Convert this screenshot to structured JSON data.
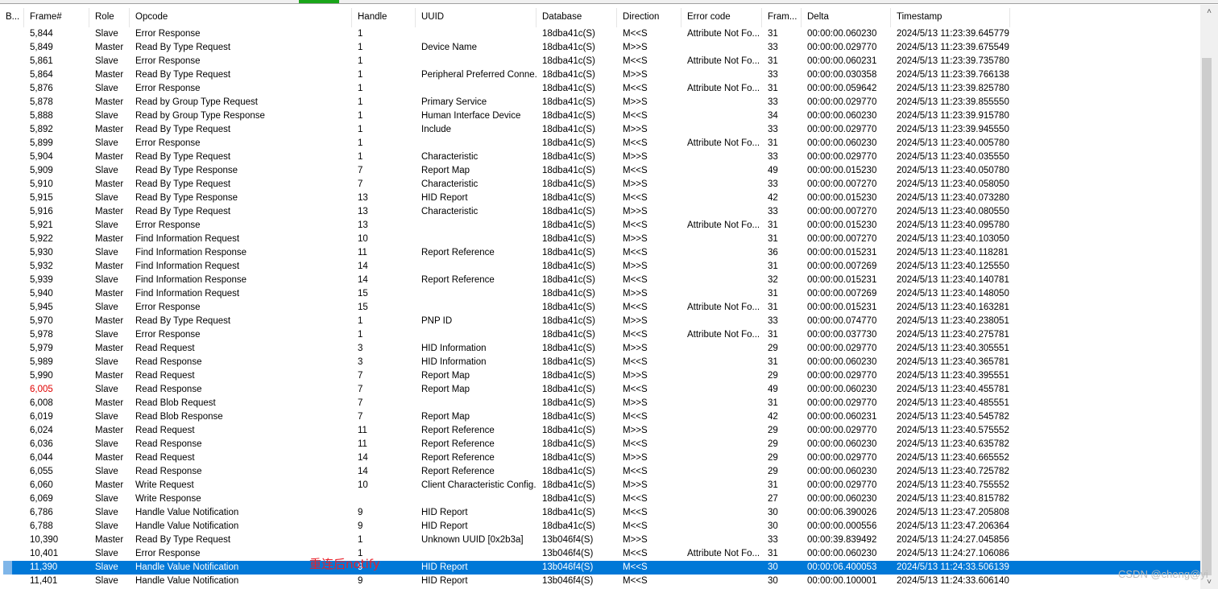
{
  "columns": [
    "B...",
    "Frame#",
    "Role",
    "Opcode",
    "Handle",
    "UUID",
    "Database",
    "Direction",
    "Error code",
    "Fram...",
    "Delta",
    "Timestamp"
  ],
  "rows": [
    [
      "",
      "5,844",
      "Slave",
      "Error Response",
      "1",
      "",
      "18dba41c(S)",
      "M<<S",
      "Attribute Not Fo...",
      "31",
      "00:00:00.060230",
      "2024/5/13 11:23:39.645779"
    ],
    [
      "",
      "5,849",
      "Master",
      "Read By Type Request",
      "1",
      "Device Name",
      "18dba41c(S)",
      "M>>S",
      "",
      "33",
      "00:00:00.029770",
      "2024/5/13 11:23:39.675549"
    ],
    [
      "",
      "5,861",
      "Slave",
      "Error Response",
      "1",
      "",
      "18dba41c(S)",
      "M<<S",
      "Attribute Not Fo...",
      "31",
      "00:00:00.060231",
      "2024/5/13 11:23:39.735780"
    ],
    [
      "",
      "5,864",
      "Master",
      "Read By Type Request",
      "1",
      "Peripheral Preferred Conne...",
      "18dba41c(S)",
      "M>>S",
      "",
      "33",
      "00:00:00.030358",
      "2024/5/13 11:23:39.766138"
    ],
    [
      "",
      "5,876",
      "Slave",
      "Error Response",
      "1",
      "",
      "18dba41c(S)",
      "M<<S",
      "Attribute Not Fo...",
      "31",
      "00:00:00.059642",
      "2024/5/13 11:23:39.825780"
    ],
    [
      "",
      "5,878",
      "Master",
      "Read by Group Type Request",
      "1",
      "Primary Service",
      "18dba41c(S)",
      "M>>S",
      "",
      "33",
      "00:00:00.029770",
      "2024/5/13 11:23:39.855550"
    ],
    [
      "",
      "5,888",
      "Slave",
      "Read by Group Type Response",
      "1",
      "Human Interface Device",
      "18dba41c(S)",
      "M<<S",
      "",
      "34",
      "00:00:00.060230",
      "2024/5/13 11:23:39.915780"
    ],
    [
      "",
      "5,892",
      "Master",
      "Read By Type Request",
      "1",
      "Include",
      "18dba41c(S)",
      "M>>S",
      "",
      "33",
      "00:00:00.029770",
      "2024/5/13 11:23:39.945550"
    ],
    [
      "",
      "5,899",
      "Slave",
      "Error Response",
      "1",
      "",
      "18dba41c(S)",
      "M<<S",
      "Attribute Not Fo...",
      "31",
      "00:00:00.060230",
      "2024/5/13 11:23:40.005780"
    ],
    [
      "",
      "5,904",
      "Master",
      "Read By Type Request",
      "1",
      "Characteristic",
      "18dba41c(S)",
      "M>>S",
      "",
      "33",
      "00:00:00.029770",
      "2024/5/13 11:23:40.035550"
    ],
    [
      "",
      "5,909",
      "Slave",
      "Read By Type Response",
      "7",
      "Report Map",
      "18dba41c(S)",
      "M<<S",
      "",
      "49",
      "00:00:00.015230",
      "2024/5/13 11:23:40.050780"
    ],
    [
      "",
      "5,910",
      "Master",
      "Read By Type Request",
      "7",
      "Characteristic",
      "18dba41c(S)",
      "M>>S",
      "",
      "33",
      "00:00:00.007270",
      "2024/5/13 11:23:40.058050"
    ],
    [
      "",
      "5,915",
      "Slave",
      "Read By Type Response",
      "13",
      "HID Report",
      "18dba41c(S)",
      "M<<S",
      "",
      "42",
      "00:00:00.015230",
      "2024/5/13 11:23:40.073280"
    ],
    [
      "",
      "5,916",
      "Master",
      "Read By Type Request",
      "13",
      "Characteristic",
      "18dba41c(S)",
      "M>>S",
      "",
      "33",
      "00:00:00.007270",
      "2024/5/13 11:23:40.080550"
    ],
    [
      "",
      "5,921",
      "Slave",
      "Error Response",
      "13",
      "",
      "18dba41c(S)",
      "M<<S",
      "Attribute Not Fo...",
      "31",
      "00:00:00.015230",
      "2024/5/13 11:23:40.095780"
    ],
    [
      "",
      "5,922",
      "Master",
      "Find Information Request",
      "10",
      "",
      "18dba41c(S)",
      "M>>S",
      "",
      "31",
      "00:00:00.007270",
      "2024/5/13 11:23:40.103050"
    ],
    [
      "",
      "5,930",
      "Slave",
      "Find Information Response",
      "11",
      "Report Reference",
      "18dba41c(S)",
      "M<<S",
      "",
      "36",
      "00:00:00.015231",
      "2024/5/13 11:23:40.118281"
    ],
    [
      "",
      "5,932",
      "Master",
      "Find Information Request",
      "14",
      "",
      "18dba41c(S)",
      "M>>S",
      "",
      "31",
      "00:00:00.007269",
      "2024/5/13 11:23:40.125550"
    ],
    [
      "",
      "5,939",
      "Slave",
      "Find Information Response",
      "14",
      "Report Reference",
      "18dba41c(S)",
      "M<<S",
      "",
      "32",
      "00:00:00.015231",
      "2024/5/13 11:23:40.140781"
    ],
    [
      "",
      "5,940",
      "Master",
      "Find Information Request",
      "15",
      "",
      "18dba41c(S)",
      "M>>S",
      "",
      "31",
      "00:00:00.007269",
      "2024/5/13 11:23:40.148050"
    ],
    [
      "",
      "5,945",
      "Slave",
      "Error Response",
      "15",
      "",
      "18dba41c(S)",
      "M<<S",
      "Attribute Not Fo...",
      "31",
      "00:00:00.015231",
      "2024/5/13 11:23:40.163281"
    ],
    [
      "",
      "5,970",
      "Master",
      "Read By Type Request",
      "1",
      "PNP ID",
      "18dba41c(S)",
      "M>>S",
      "",
      "33",
      "00:00:00.074770",
      "2024/5/13 11:23:40.238051"
    ],
    [
      "",
      "5,978",
      "Slave",
      "Error Response",
      "1",
      "",
      "18dba41c(S)",
      "M<<S",
      "Attribute Not Fo...",
      "31",
      "00:00:00.037730",
      "2024/5/13 11:23:40.275781"
    ],
    [
      "",
      "5,979",
      "Master",
      "Read Request",
      "3",
      "HID Information",
      "18dba41c(S)",
      "M>>S",
      "",
      "29",
      "00:00:00.029770",
      "2024/5/13 11:23:40.305551"
    ],
    [
      "",
      "5,989",
      "Slave",
      "Read Response",
      "3",
      "HID Information",
      "18dba41c(S)",
      "M<<S",
      "",
      "31",
      "00:00:00.060230",
      "2024/5/13 11:23:40.365781"
    ],
    [
      "",
      "5,990",
      "Master",
      "Read Request",
      "7",
      "Report Map",
      "18dba41c(S)",
      "M>>S",
      "",
      "29",
      "00:00:00.029770",
      "2024/5/13 11:23:40.395551"
    ],
    [
      "",
      "6,005",
      "Slave",
      "Read Response",
      "7",
      "Report Map",
      "18dba41c(S)",
      "M<<S",
      "",
      "49",
      "00:00:00.060230",
      "2024/5/13 11:23:40.455781"
    ],
    [
      "",
      "6,008",
      "Master",
      "Read Blob Request",
      "7",
      "",
      "18dba41c(S)",
      "M>>S",
      "",
      "31",
      "00:00:00.029770",
      "2024/5/13 11:23:40.485551"
    ],
    [
      "",
      "6,019",
      "Slave",
      "Read Blob Response",
      "7",
      "Report Map",
      "18dba41c(S)",
      "M<<S",
      "",
      "42",
      "00:00:00.060231",
      "2024/5/13 11:23:40.545782"
    ],
    [
      "",
      "6,024",
      "Master",
      "Read Request",
      "11",
      "Report Reference",
      "18dba41c(S)",
      "M>>S",
      "",
      "29",
      "00:00:00.029770",
      "2024/5/13 11:23:40.575552"
    ],
    [
      "",
      "6,036",
      "Slave",
      "Read Response",
      "11",
      "Report Reference",
      "18dba41c(S)",
      "M<<S",
      "",
      "29",
      "00:00:00.060230",
      "2024/5/13 11:23:40.635782"
    ],
    [
      "",
      "6,044",
      "Master",
      "Read Request",
      "14",
      "Report Reference",
      "18dba41c(S)",
      "M>>S",
      "",
      "29",
      "00:00:00.029770",
      "2024/5/13 11:23:40.665552"
    ],
    [
      "",
      "6,055",
      "Slave",
      "Read Response",
      "14",
      "Report Reference",
      "18dba41c(S)",
      "M<<S",
      "",
      "29",
      "00:00:00.060230",
      "2024/5/13 11:23:40.725782"
    ],
    [
      "",
      "6,060",
      "Master",
      "Write Request",
      "10",
      "Client Characteristic Config...",
      "18dba41c(S)",
      "M>>S",
      "",
      "31",
      "00:00:00.029770",
      "2024/5/13 11:23:40.755552"
    ],
    [
      "",
      "6,069",
      "Slave",
      "Write Response",
      "",
      "",
      "18dba41c(S)",
      "M<<S",
      "",
      "27",
      "00:00:00.060230",
      "2024/5/13 11:23:40.815782"
    ],
    [
      "",
      "6,786",
      "Slave",
      "Handle Value Notification",
      "9",
      "HID Report",
      "18dba41c(S)",
      "M<<S",
      "",
      "30",
      "00:00:06.390026",
      "2024/5/13 11:23:47.205808"
    ],
    [
      "",
      "6,788",
      "Slave",
      "Handle Value Notification",
      "9",
      "HID Report",
      "18dba41c(S)",
      "M<<S",
      "",
      "30",
      "00:00:00.000556",
      "2024/5/13 11:23:47.206364"
    ],
    [
      "",
      "10,390",
      "Master",
      "Read By Type Request",
      "1",
      "Unknown UUID [0x2b3a]",
      "13b046f4(S)",
      "M>>S",
      "",
      "33",
      "00:00:39.839492",
      "2024/5/13 11:24:27.045856"
    ],
    [
      "",
      "10,401",
      "Slave",
      "Error Response",
      "1",
      "",
      "13b046f4(S)",
      "M<<S",
      "Attribute Not Fo...",
      "31",
      "00:00:00.060230",
      "2024/5/13 11:24:27.106086"
    ],
    [
      "",
      "11,390",
      "Slave",
      "Handle Value Notification",
      "9",
      "HID Report",
      "13b046f4(S)",
      "M<<S",
      "",
      "30",
      "00:00:06.400053",
      "2024/5/13 11:24:33.506139"
    ],
    [
      "",
      "11,401",
      "Slave",
      "Handle Value Notification",
      "9",
      "HID Report",
      "13b046f4(S)",
      "M<<S",
      "",
      "30",
      "00:00:00.100001",
      "2024/5/13 11:24:33.606140"
    ]
  ],
  "selected_row_frame": "11,390",
  "red_frame": "6,005",
  "annotation": "重连后notify",
  "watermark": "CSDN @cheng@yi",
  "colors": {
    "selection": "#0078d7",
    "annotation": "#e8202a",
    "active_tab": "#1aa51a"
  },
  "scrollbar": {
    "up_icon": "chevron-up-icon",
    "down_icon": "chevron-down-icon"
  }
}
